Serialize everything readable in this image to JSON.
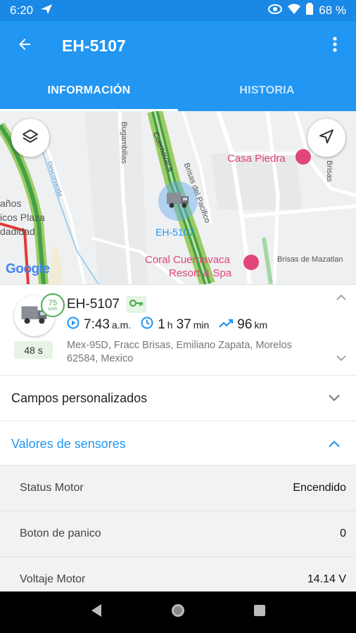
{
  "status_bar": {
    "time": "6:20",
    "battery": "68 %"
  },
  "app_bar": {
    "title": "EH-5107"
  },
  "tabs": [
    {
      "label": "INFORMACIÓN",
      "active": true
    },
    {
      "label": "HISTORIA",
      "active": false
    }
  ],
  "map": {
    "labels": {
      "casa_piedra": "Casa Piedra",
      "vehicle_label": "EH-5107",
      "coral_line1": "Coral Cuernavaca",
      "coral_line2": "Resort & Spa",
      "brisas_mazatlan": "Brisas de Mazatlan",
      "brisas_pacifico": "Brisas del Pacifico",
      "bugambilias": "Bugambilias",
      "cuernavaca": "Cuernavaca",
      "desconocida": "Desconocida",
      "brisas_right": "Brisas",
      "left1": "años",
      "left2": "icos Plaza",
      "left3": "dadidad",
      "google": "Google"
    }
  },
  "vehicle": {
    "name": "EH-5107",
    "speed_value": "75",
    "speed_unit": "km/h",
    "age": "48 s",
    "time_value": "7:43",
    "time_suffix": "a.m.",
    "duration_h_value": "1",
    "duration_h_unit": "h",
    "duration_m_value": "37",
    "duration_m_unit": "min",
    "distance_value": "96",
    "distance_unit": "km",
    "address": "Mex-95D, Fracc Brisas, Emiliano Zapata, Morelos 62584, Mexico"
  },
  "sections": {
    "custom_fields": "Campos personalizados",
    "sensor_values": "Valores de sensores"
  },
  "sensors": [
    {
      "label": "Status Motor",
      "value": "Encendido"
    },
    {
      "label": "Boton de panico",
      "value": "0"
    },
    {
      "label": "Voltaje Motor",
      "value": "14.14 V"
    }
  ],
  "colors": {
    "primary": "#2196f3",
    "accent_green": "#4caf50",
    "pink_poi": "#e0457b"
  },
  "icons": {
    "back": "arrow-left-icon",
    "more": "more-vertical-icon",
    "layers": "layers-icon",
    "navigate": "navigation-arrow-icon"
  }
}
